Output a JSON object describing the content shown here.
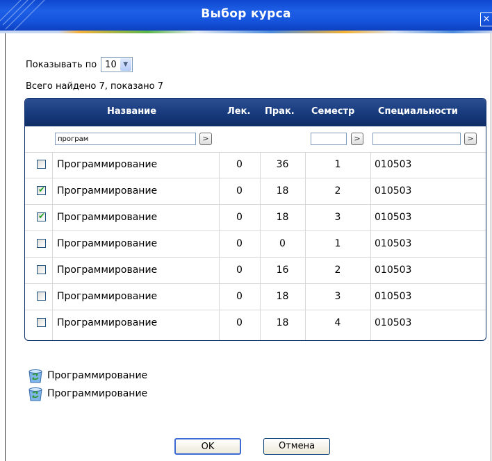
{
  "window": {
    "title": "Выбор курса",
    "close_glyph": "×",
    "colors": {
      "titlebar": "#1553dc",
      "grid_header": "#173a7c",
      "check": "#21a121"
    }
  },
  "pager": {
    "label": "Показывать по",
    "page_size": "10"
  },
  "summary": "Всего найдено 7, показано 7",
  "table": {
    "columns": [
      "Название",
      "Лек.",
      "Прак.",
      "Семестр",
      "Специальности"
    ],
    "filters": {
      "name": "програм",
      "semester": "",
      "speciality": ""
    },
    "filter_button_glyph": ">",
    "rows": [
      {
        "checked": false,
        "name": "Программирование",
        "lec": "0",
        "prac": "36",
        "sem": "1",
        "spec": "010503"
      },
      {
        "checked": true,
        "name": "Программирование",
        "lec": "0",
        "prac": "18",
        "sem": "2",
        "spec": "010503"
      },
      {
        "checked": true,
        "name": "Программирование",
        "lec": "0",
        "prac": "18",
        "sem": "3",
        "spec": "010503"
      },
      {
        "checked": false,
        "name": "Программирование",
        "lec": "0",
        "prac": "0",
        "sem": "1",
        "spec": "010503"
      },
      {
        "checked": false,
        "name": "Программирование",
        "lec": "0",
        "prac": "16",
        "sem": "2",
        "spec": "010503"
      },
      {
        "checked": false,
        "name": "Программирование",
        "lec": "0",
        "prac": "18",
        "sem": "3",
        "spec": "010503"
      },
      {
        "checked": false,
        "name": "Программирование",
        "lec": "0",
        "prac": "18",
        "sem": "4",
        "spec": "010503"
      }
    ]
  },
  "selected": [
    {
      "icon": "recycle-bin-icon",
      "label": "Программирование"
    },
    {
      "icon": "recycle-bin-icon",
      "label": "Программирование"
    }
  ],
  "buttons": {
    "ok": "OK",
    "cancel": "Отмена"
  }
}
